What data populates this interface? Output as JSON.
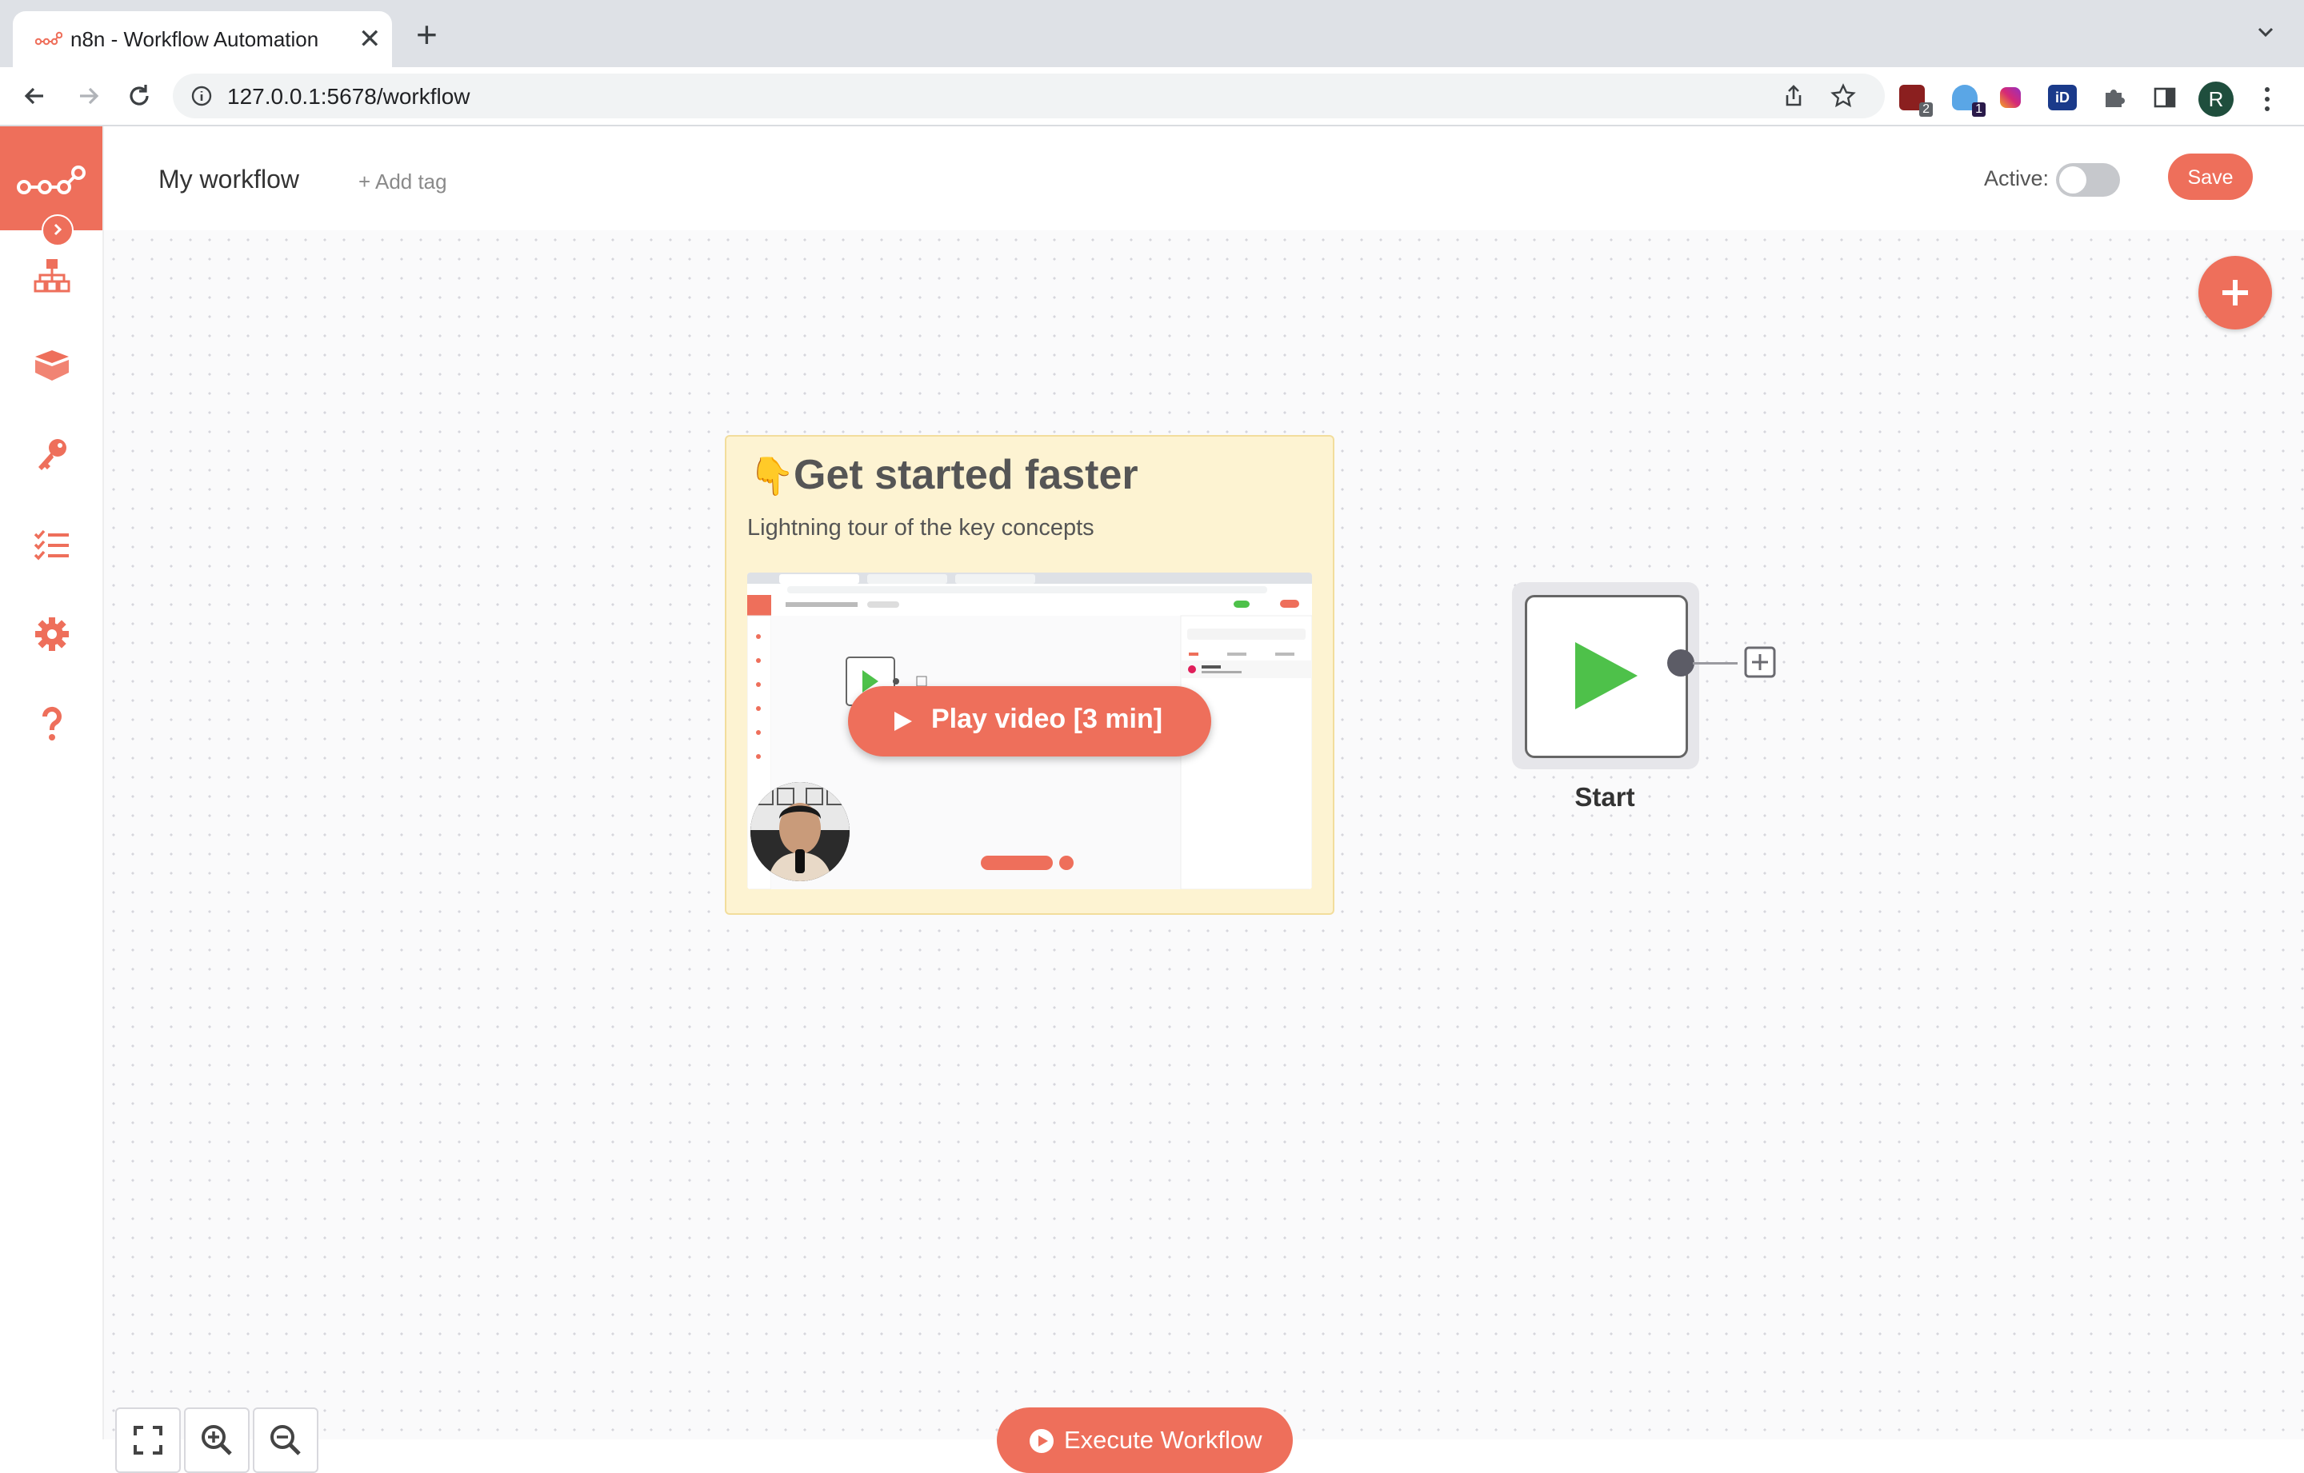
{
  "browser": {
    "tab_title": "n8n - Workflow Automation",
    "tab_close": "✕",
    "new_tab": "+",
    "url": "127.0.0.1:5678/workflow",
    "profile_initial": "R",
    "extension_badges": [
      "2",
      "1"
    ],
    "extension_id_label": "iD"
  },
  "header": {
    "workflow_name": "My workflow",
    "add_tag": "+ Add tag",
    "active_label": "Active:",
    "active": false,
    "save_label": "Save"
  },
  "sidebar": {
    "items": [
      {
        "icon": "workflows-icon"
      },
      {
        "icon": "templates-icon"
      },
      {
        "icon": "credentials-icon"
      },
      {
        "icon": "executions-icon"
      },
      {
        "icon": "settings-icon"
      },
      {
        "icon": "help-icon"
      }
    ]
  },
  "sticky": {
    "emoji": "👇",
    "title": "Get started faster",
    "subtitle": "Lightning tour of the key concepts",
    "play_label": "Play video [3 min]"
  },
  "node": {
    "label": "Start"
  },
  "canvas": {
    "execute_label": "Execute Workflow"
  },
  "colors": {
    "brand": "#ee6f5b",
    "play_green": "#4ec14a",
    "sticky_bg": "#fdf3d2"
  }
}
